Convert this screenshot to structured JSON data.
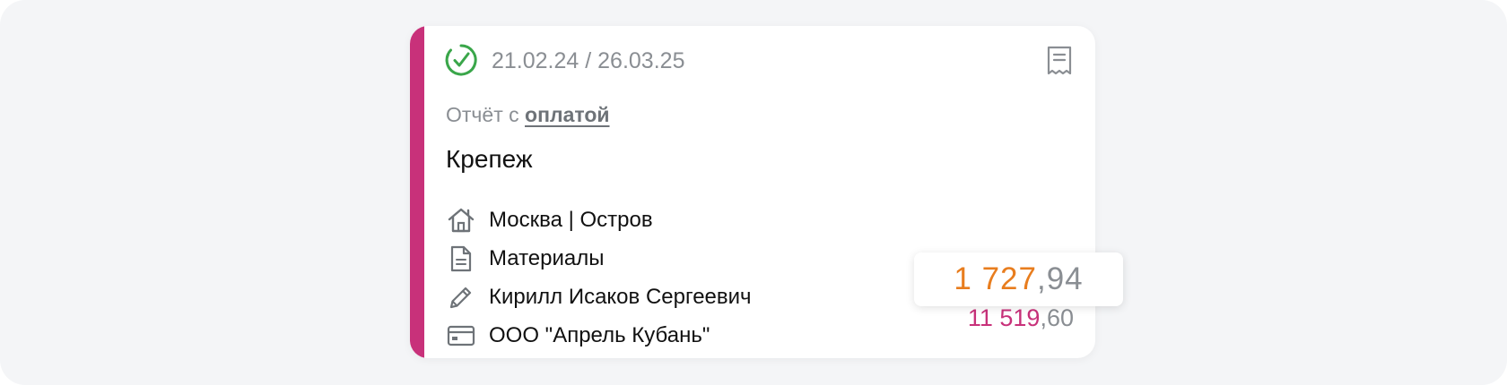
{
  "card": {
    "dates": "21.02.24 / 26.03.25",
    "report_prefix": "Отчёт с",
    "report_link": "оплатой",
    "title": "Крепеж",
    "details": [
      {
        "icon": "home-icon",
        "text": "Москва | Остров"
      },
      {
        "icon": "document-icon",
        "text": "Материалы"
      },
      {
        "icon": "pencil-icon",
        "text": "Кирилл Исаков Сергеевич"
      },
      {
        "icon": "credit-card-icon",
        "text": "ООО \"Апрель Кубань\""
      }
    ],
    "amount_total": {
      "integer": "11 519",
      "fraction": ",60"
    }
  },
  "popup": {
    "amount": {
      "integer": "1 727",
      "fraction": ",94"
    }
  },
  "colors": {
    "accent": "#c8317a",
    "status_green": "#3aa64a",
    "amount_orange": "#e87d1e",
    "muted_text": "#8a8e93"
  }
}
